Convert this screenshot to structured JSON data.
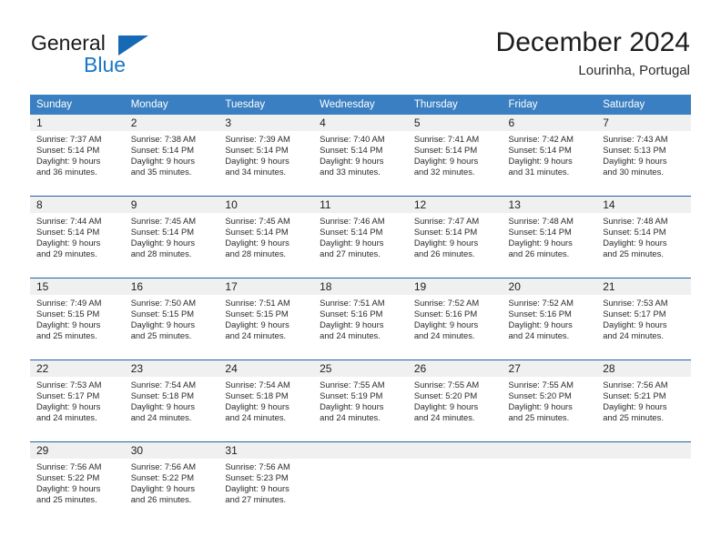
{
  "brand": {
    "line1": "General",
    "line2": "Blue",
    "mark": "triangle-logo",
    "color": "#1977c4"
  },
  "header": {
    "title": "December 2024",
    "subtitle": "Lourinha, Portugal"
  },
  "theme": {
    "header_blue": "#3a7fc1",
    "rule_blue": "#1f63a8",
    "daynum_band": "#f0f0f0"
  },
  "weekdays": [
    "Sunday",
    "Monday",
    "Tuesday",
    "Wednesday",
    "Thursday",
    "Friday",
    "Saturday"
  ],
  "weeks": [
    [
      {
        "day": "1",
        "sunrise": "Sunrise: 7:37 AM",
        "sunset": "Sunset: 5:14 PM",
        "daylight1": "Daylight: 9 hours",
        "daylight2": "and 36 minutes."
      },
      {
        "day": "2",
        "sunrise": "Sunrise: 7:38 AM",
        "sunset": "Sunset: 5:14 PM",
        "daylight1": "Daylight: 9 hours",
        "daylight2": "and 35 minutes."
      },
      {
        "day": "3",
        "sunrise": "Sunrise: 7:39 AM",
        "sunset": "Sunset: 5:14 PM",
        "daylight1": "Daylight: 9 hours",
        "daylight2": "and 34 minutes."
      },
      {
        "day": "4",
        "sunrise": "Sunrise: 7:40 AM",
        "sunset": "Sunset: 5:14 PM",
        "daylight1": "Daylight: 9 hours",
        "daylight2": "and 33 minutes."
      },
      {
        "day": "5",
        "sunrise": "Sunrise: 7:41 AM",
        "sunset": "Sunset: 5:14 PM",
        "daylight1": "Daylight: 9 hours",
        "daylight2": "and 32 minutes."
      },
      {
        "day": "6",
        "sunrise": "Sunrise: 7:42 AM",
        "sunset": "Sunset: 5:14 PM",
        "daylight1": "Daylight: 9 hours",
        "daylight2": "and 31 minutes."
      },
      {
        "day": "7",
        "sunrise": "Sunrise: 7:43 AM",
        "sunset": "Sunset: 5:13 PM",
        "daylight1": "Daylight: 9 hours",
        "daylight2": "and 30 minutes."
      }
    ],
    [
      {
        "day": "8",
        "sunrise": "Sunrise: 7:44 AM",
        "sunset": "Sunset: 5:14 PM",
        "daylight1": "Daylight: 9 hours",
        "daylight2": "and 29 minutes."
      },
      {
        "day": "9",
        "sunrise": "Sunrise: 7:45 AM",
        "sunset": "Sunset: 5:14 PM",
        "daylight1": "Daylight: 9 hours",
        "daylight2": "and 28 minutes."
      },
      {
        "day": "10",
        "sunrise": "Sunrise: 7:45 AM",
        "sunset": "Sunset: 5:14 PM",
        "daylight1": "Daylight: 9 hours",
        "daylight2": "and 28 minutes."
      },
      {
        "day": "11",
        "sunrise": "Sunrise: 7:46 AM",
        "sunset": "Sunset: 5:14 PM",
        "daylight1": "Daylight: 9 hours",
        "daylight2": "and 27 minutes."
      },
      {
        "day": "12",
        "sunrise": "Sunrise: 7:47 AM",
        "sunset": "Sunset: 5:14 PM",
        "daylight1": "Daylight: 9 hours",
        "daylight2": "and 26 minutes."
      },
      {
        "day": "13",
        "sunrise": "Sunrise: 7:48 AM",
        "sunset": "Sunset: 5:14 PM",
        "daylight1": "Daylight: 9 hours",
        "daylight2": "and 26 minutes."
      },
      {
        "day": "14",
        "sunrise": "Sunrise: 7:48 AM",
        "sunset": "Sunset: 5:14 PM",
        "daylight1": "Daylight: 9 hours",
        "daylight2": "and 25 minutes."
      }
    ],
    [
      {
        "day": "15",
        "sunrise": "Sunrise: 7:49 AM",
        "sunset": "Sunset: 5:15 PM",
        "daylight1": "Daylight: 9 hours",
        "daylight2": "and 25 minutes."
      },
      {
        "day": "16",
        "sunrise": "Sunrise: 7:50 AM",
        "sunset": "Sunset: 5:15 PM",
        "daylight1": "Daylight: 9 hours",
        "daylight2": "and 25 minutes."
      },
      {
        "day": "17",
        "sunrise": "Sunrise: 7:51 AM",
        "sunset": "Sunset: 5:15 PM",
        "daylight1": "Daylight: 9 hours",
        "daylight2": "and 24 minutes."
      },
      {
        "day": "18",
        "sunrise": "Sunrise: 7:51 AM",
        "sunset": "Sunset: 5:16 PM",
        "daylight1": "Daylight: 9 hours",
        "daylight2": "and 24 minutes."
      },
      {
        "day": "19",
        "sunrise": "Sunrise: 7:52 AM",
        "sunset": "Sunset: 5:16 PM",
        "daylight1": "Daylight: 9 hours",
        "daylight2": "and 24 minutes."
      },
      {
        "day": "20",
        "sunrise": "Sunrise: 7:52 AM",
        "sunset": "Sunset: 5:16 PM",
        "daylight1": "Daylight: 9 hours",
        "daylight2": "and 24 minutes."
      },
      {
        "day": "21",
        "sunrise": "Sunrise: 7:53 AM",
        "sunset": "Sunset: 5:17 PM",
        "daylight1": "Daylight: 9 hours",
        "daylight2": "and 24 minutes."
      }
    ],
    [
      {
        "day": "22",
        "sunrise": "Sunrise: 7:53 AM",
        "sunset": "Sunset: 5:17 PM",
        "daylight1": "Daylight: 9 hours",
        "daylight2": "and 24 minutes."
      },
      {
        "day": "23",
        "sunrise": "Sunrise: 7:54 AM",
        "sunset": "Sunset: 5:18 PM",
        "daylight1": "Daylight: 9 hours",
        "daylight2": "and 24 minutes."
      },
      {
        "day": "24",
        "sunrise": "Sunrise: 7:54 AM",
        "sunset": "Sunset: 5:18 PM",
        "daylight1": "Daylight: 9 hours",
        "daylight2": "and 24 minutes."
      },
      {
        "day": "25",
        "sunrise": "Sunrise: 7:55 AM",
        "sunset": "Sunset: 5:19 PM",
        "daylight1": "Daylight: 9 hours",
        "daylight2": "and 24 minutes."
      },
      {
        "day": "26",
        "sunrise": "Sunrise: 7:55 AM",
        "sunset": "Sunset: 5:20 PM",
        "daylight1": "Daylight: 9 hours",
        "daylight2": "and 24 minutes."
      },
      {
        "day": "27",
        "sunrise": "Sunrise: 7:55 AM",
        "sunset": "Sunset: 5:20 PM",
        "daylight1": "Daylight: 9 hours",
        "daylight2": "and 25 minutes."
      },
      {
        "day": "28",
        "sunrise": "Sunrise: 7:56 AM",
        "sunset": "Sunset: 5:21 PM",
        "daylight1": "Daylight: 9 hours",
        "daylight2": "and 25 minutes."
      }
    ],
    [
      {
        "day": "29",
        "sunrise": "Sunrise: 7:56 AM",
        "sunset": "Sunset: 5:22 PM",
        "daylight1": "Daylight: 9 hours",
        "daylight2": "and 25 minutes."
      },
      {
        "day": "30",
        "sunrise": "Sunrise: 7:56 AM",
        "sunset": "Sunset: 5:22 PM",
        "daylight1": "Daylight: 9 hours",
        "daylight2": "and 26 minutes."
      },
      {
        "day": "31",
        "sunrise": "Sunrise: 7:56 AM",
        "sunset": "Sunset: 5:23 PM",
        "daylight1": "Daylight: 9 hours",
        "daylight2": "and 27 minutes."
      },
      {
        "day": "",
        "sunrise": "",
        "sunset": "",
        "daylight1": "",
        "daylight2": ""
      },
      {
        "day": "",
        "sunrise": "",
        "sunset": "",
        "daylight1": "",
        "daylight2": ""
      },
      {
        "day": "",
        "sunrise": "",
        "sunset": "",
        "daylight1": "",
        "daylight2": ""
      },
      {
        "day": "",
        "sunrise": "",
        "sunset": "",
        "daylight1": "",
        "daylight2": ""
      }
    ]
  ]
}
